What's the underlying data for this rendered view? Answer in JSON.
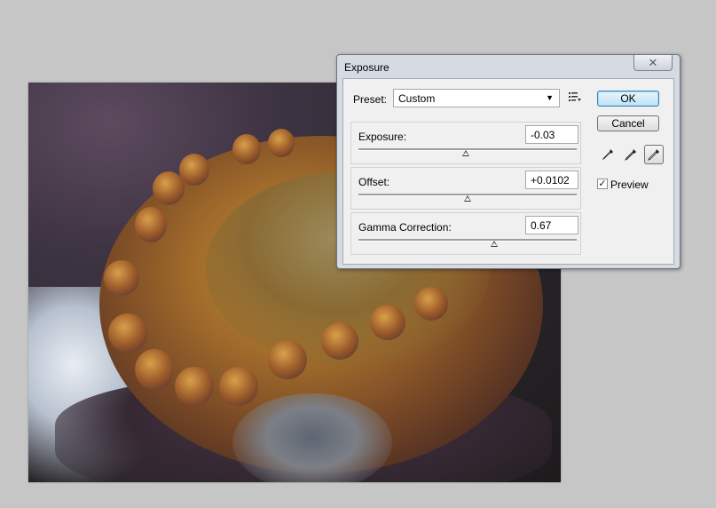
{
  "dialog": {
    "title": "Exposure",
    "close_glyph": "✕",
    "preset": {
      "label": "Preset:",
      "value": "Custom"
    },
    "exposure": {
      "label": "Exposure:",
      "value": "-0.03",
      "slider_position": 0.49
    },
    "offset": {
      "label": "Offset:",
      "value": "+0.0102",
      "slider_position": 0.5
    },
    "gamma": {
      "label": "Gamma Correction:",
      "value": "0.67",
      "slider_position": 0.62
    },
    "buttons": {
      "ok": "OK",
      "cancel": "Cancel"
    },
    "eyedroppers": [
      "black-point-eyedropper-icon",
      "gray-point-eyedropper-icon",
      "white-point-eyedropper-icon"
    ],
    "preview": {
      "label": "Preview",
      "checked": true,
      "mark": "✓"
    }
  },
  "colors": {
    "canvas_background": "#c6c6c6",
    "dialog_frame": "#d6dbe3",
    "default_button": "#bfe3f8"
  }
}
